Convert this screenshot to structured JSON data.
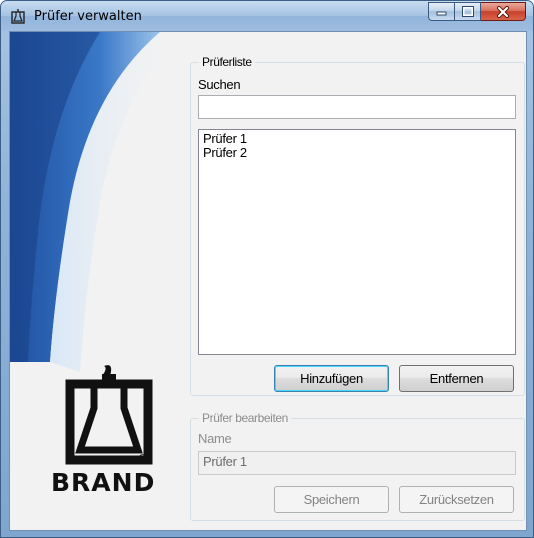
{
  "window": {
    "title": "Prüfer verwalten"
  },
  "brand": {
    "logo_text": "BRAND",
    "registered": "®"
  },
  "tester_list": {
    "group_title": "Prüferliste",
    "search_label": "Suchen",
    "search_value": "",
    "items": [
      "Prüfer 1",
      "Prüfer 2"
    ],
    "add_label": "Hinzufügen",
    "remove_label": "Entfernen"
  },
  "edit_tester": {
    "group_title": "Prüfer bearbeiten",
    "name_label": "Name",
    "name_value": "Prüfer 1",
    "save_label": "Speichern",
    "reset_label": "Zurücksetzen"
  },
  "colors": {
    "frame": "#8fb2d8",
    "close_button": "#c7412b",
    "client_bg": "#f2f2f2"
  }
}
